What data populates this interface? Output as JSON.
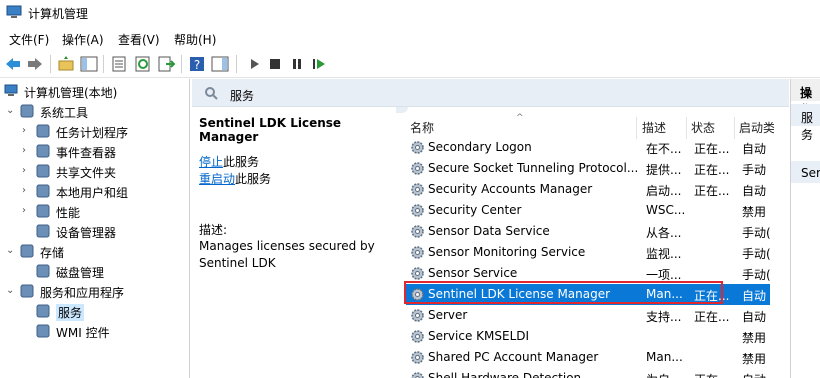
{
  "window": {
    "title": "计算机管理",
    "icon": "computer-management-icon"
  },
  "menu": [
    "文件(F)",
    "操作(A)",
    "查看(V)",
    "帮助(H)"
  ],
  "toolbar": {
    "icons": [
      "back-icon",
      "forward-icon",
      "up-folder-icon",
      "show-hide-tree-icon",
      "properties-icon",
      "refresh-icon",
      "export-icon",
      "help-icon",
      "show-hide-action-pane-icon",
      "start-icon",
      "stop-icon",
      "pause-icon",
      "restart-icon"
    ]
  },
  "tree": {
    "root": "计算机管理(本地)",
    "items": [
      {
        "label": "系统工具",
        "icon": "tools-icon",
        "level": 1,
        "expander": "v"
      },
      {
        "label": "任务计划程序",
        "icon": "clock-icon",
        "level": 2,
        "expander": ">"
      },
      {
        "label": "事件查看器",
        "icon": "event-viewer-icon",
        "level": 2,
        "expander": ">"
      },
      {
        "label": "共享文件夹",
        "icon": "shared-folder-icon",
        "level": 2,
        "expander": ">"
      },
      {
        "label": "本地用户和组",
        "icon": "users-icon",
        "level": 2,
        "expander": ">"
      },
      {
        "label": "性能",
        "icon": "performance-icon",
        "level": 2,
        "expander": ">"
      },
      {
        "label": "设备管理器",
        "icon": "device-manager-icon",
        "level": 2,
        "expander": ""
      },
      {
        "label": "存储",
        "icon": "storage-icon",
        "level": 1,
        "expander": "v"
      },
      {
        "label": "磁盘管理",
        "icon": "disk-icon",
        "level": 2,
        "expander": ""
      },
      {
        "label": "服务和应用程序",
        "icon": "services-apps-icon",
        "level": 1,
        "expander": "v"
      },
      {
        "label": "服务",
        "icon": "services-gear-icon",
        "level": 2,
        "expander": "",
        "selected": true
      },
      {
        "label": "WMI 控件",
        "icon": "wmi-icon",
        "level": 2,
        "expander": ""
      }
    ]
  },
  "center": {
    "header": "服务",
    "detail": {
      "title": "Sentinel LDK License Manager",
      "stop_link": "停止",
      "stop_suffix": "此服务",
      "restart_link": "重启动",
      "restart_suffix": "此服务",
      "desc_label": "描述:",
      "desc_text": "Manages licenses secured by Sentinel LDK"
    },
    "columns": {
      "name": "名称",
      "description": "描述",
      "status": "状态",
      "startup": "启动类"
    },
    "rows": [
      {
        "name": "Secondary Logon",
        "description": "在不...",
        "status": "正在...",
        "startup": "自动"
      },
      {
        "name": "Secure Socket Tunneling Protocol...",
        "description": "提供...",
        "status": "正在...",
        "startup": "手动"
      },
      {
        "name": "Security Accounts Manager",
        "description": "启动...",
        "status": "正在...",
        "startup": "自动"
      },
      {
        "name": "Security Center",
        "description": "WSC...",
        "status": "",
        "startup": "禁用"
      },
      {
        "name": "Sensor Data Service",
        "description": "从各...",
        "status": "",
        "startup": "手动("
      },
      {
        "name": "Sensor Monitoring Service",
        "description": "监视...",
        "status": "",
        "startup": "手动("
      },
      {
        "name": "Sensor Service",
        "description": "一项...",
        "status": "",
        "startup": "手动("
      },
      {
        "name": "Sentinel LDK License Manager",
        "description": "Man...",
        "status": "正在...",
        "startup": "自动",
        "selected": true
      },
      {
        "name": "Server",
        "description": "支持...",
        "status": "正在...",
        "startup": "自动"
      },
      {
        "name": "Service KMSELDI",
        "description": "",
        "status": "",
        "startup": "禁用"
      },
      {
        "name": "Shared PC Account Manager",
        "description": "Man...",
        "status": "",
        "startup": "禁用"
      },
      {
        "name": "Shell Hardware Detection",
        "description": "为自...",
        "status": "正在...",
        "startup": "自动"
      }
    ]
  },
  "actions": {
    "header": "操作",
    "items": [
      "服务",
      "Ser"
    ]
  },
  "colors": {
    "selection": "#0a78d7",
    "highlight_box": "#e0262f",
    "header_band": "#e8eef6",
    "link": "#0066cc"
  }
}
